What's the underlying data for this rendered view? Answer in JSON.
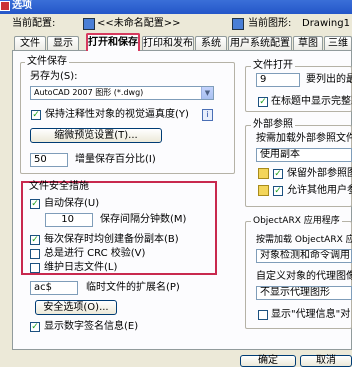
{
  "window": {
    "title": "选项",
    "current_config_label": "当前配置:",
    "current_config_value": "<<未命名配置>>",
    "current_drawing_label": "当前图形:",
    "current_drawing_value": "Drawing1"
  },
  "tabs": [
    "文件",
    "显示",
    "打开和保存",
    "打印和发布",
    "系统",
    "用户系统配置",
    "草图",
    "三维"
  ],
  "file_save": {
    "title": "文件保存",
    "save_as_label": "另存为(S):",
    "save_as_value": "AutoCAD 2007 图形 (*.dwg)",
    "keep_visual_fidelity": "保持注释性对象的视觉逼真度(Y)",
    "thumbnail_button": "缩微预览设置(T)...",
    "incremental_value": "50",
    "incremental_label": "增量保存百分比(I)"
  },
  "file_safety": {
    "title": "文件安全措施",
    "autosave": "自动保存(U)",
    "interval_value": "10",
    "interval_label": "保存间隔分钟数(M)",
    "backup": "每次保存时均创建备份副本(B)",
    "crc": "总是进行 CRC 校验(V)",
    "log": "维护日志文件(L)",
    "temp_ext_value": "ac$",
    "temp_ext_label": "临时文件的扩展名(P)",
    "security_button": "安全选项(O)...",
    "digital_sig": "显示数字签名信息(E)"
  },
  "file_open": {
    "title": "文件打开",
    "recent_value": "9",
    "recent_label": "要列出的最",
    "full_path": "在标题中显示完整路"
  },
  "xref": {
    "title": "外部参照",
    "demand_load_label": "按需加载外部参照文件(",
    "demand_load_value": "使用副本",
    "retain_changes": "保留外部参照图",
    "allow_others": "允许其他用户参"
  },
  "objectarx": {
    "title": "ObjectARX 应用程序",
    "demand_load_label": "按需加载 ObjectARX 应用",
    "demand_load_value": "对象检测和命令调用",
    "proxy_label": "自定义对象的代理图像",
    "proxy_value": "不显示代理图形",
    "proxy_info": "显示\"代理信息\"对"
  },
  "footer": {
    "ok_button": "确定",
    "cancel_button": "取消"
  }
}
